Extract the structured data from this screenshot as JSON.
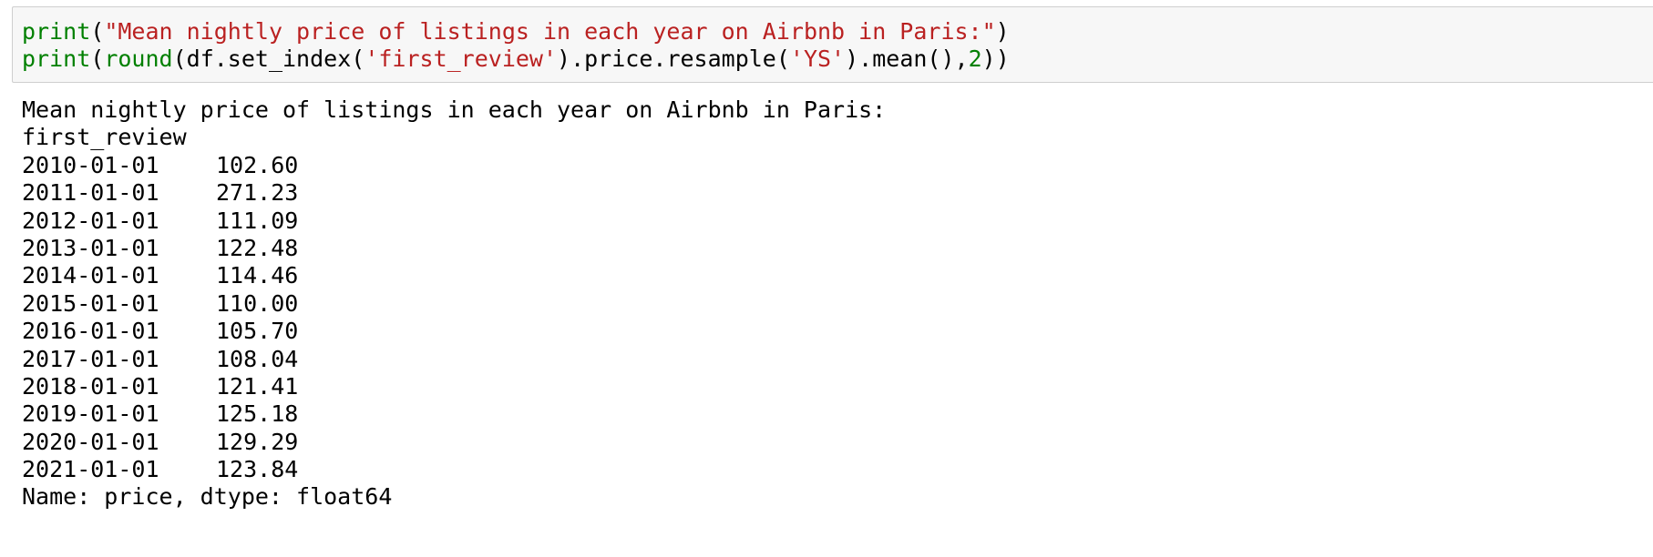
{
  "input_cell": {
    "line1": {
      "fn": "print",
      "open": "(",
      "string": "\"Mean nightly price of listings in each year on Airbnb in Paris:\"",
      "close": ")"
    },
    "line2": {
      "fn_print": "print",
      "open1": "(",
      "fn_round": "round",
      "mid1": "(df.set_index(",
      "arg_index": "'first_review'",
      "mid2": ").price.resample(",
      "arg_rule": "'YS'",
      "mid3": ").mean(),",
      "digits": "2",
      "close": "))"
    }
  },
  "output": {
    "header": "Mean nightly price of listings in each year on Airbnb in Paris:",
    "index_name": "first_review",
    "rows": [
      {
        "date": "2010-01-01",
        "price": "102.60"
      },
      {
        "date": "2011-01-01",
        "price": "271.23"
      },
      {
        "date": "2012-01-01",
        "price": "111.09"
      },
      {
        "date": "2013-01-01",
        "price": "122.48"
      },
      {
        "date": "2014-01-01",
        "price": "114.46"
      },
      {
        "date": "2015-01-01",
        "price": "110.00"
      },
      {
        "date": "2016-01-01",
        "price": "105.70"
      },
      {
        "date": "2017-01-01",
        "price": "108.04"
      },
      {
        "date": "2018-01-01",
        "price": "121.41"
      },
      {
        "date": "2019-01-01",
        "price": "125.18"
      },
      {
        "date": "2020-01-01",
        "price": "129.29"
      },
      {
        "date": "2021-01-01",
        "price": "123.84"
      }
    ],
    "footer": "Name: price, dtype: float64"
  },
  "colors": {
    "builtin": "#008000",
    "string": "#ba2121",
    "input_bg": "#f7f7f7",
    "input_border": "#cfcfcf"
  }
}
